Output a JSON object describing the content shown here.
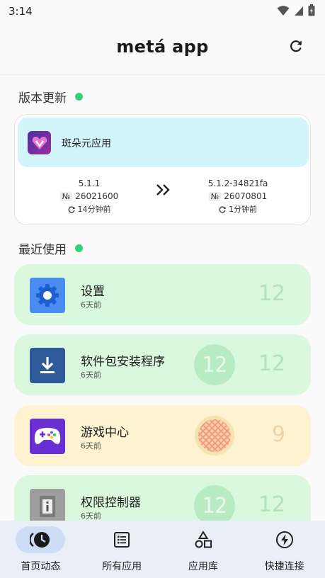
{
  "status": {
    "time": "3:14"
  },
  "header": {
    "title": "metá app"
  },
  "updates": {
    "label": "版本更新",
    "card": {
      "name": "斑朵元应用",
      "from": {
        "version": "5.1.1",
        "code_label": "№",
        "code": "26021600",
        "ago": "14分钟前"
      },
      "to": {
        "version": "5.1.2-34821fa",
        "code_label": "№",
        "code": "26070801",
        "ago": "1分钟前"
      }
    }
  },
  "recent": {
    "label": "最近使用",
    "items": [
      {
        "name": "设置",
        "time": "6天前",
        "api": "12"
      },
      {
        "name": "软件包安装程序",
        "time": "6天前",
        "api": "12",
        "badge": "12"
      },
      {
        "name": "游戏中心",
        "time": "6天前",
        "api": "9"
      },
      {
        "name": "权限控制器",
        "time": "6天前",
        "api": "12",
        "badge": "12"
      }
    ]
  },
  "nav": {
    "items": [
      {
        "label": "首页动态",
        "icon": "clock-icon",
        "active": true
      },
      {
        "label": "所有应用",
        "icon": "list-icon"
      },
      {
        "label": "应用库",
        "icon": "shapes-icon"
      },
      {
        "label": "快捷连接",
        "icon": "bolt-icon"
      }
    ]
  },
  "colors": {
    "accent_dot": "#35d07f",
    "card_green": "#d9f8dd",
    "card_yellow": "#fdf3d0",
    "update_head": "#d2f5fb",
    "nav_bg": "#e9eff7"
  }
}
